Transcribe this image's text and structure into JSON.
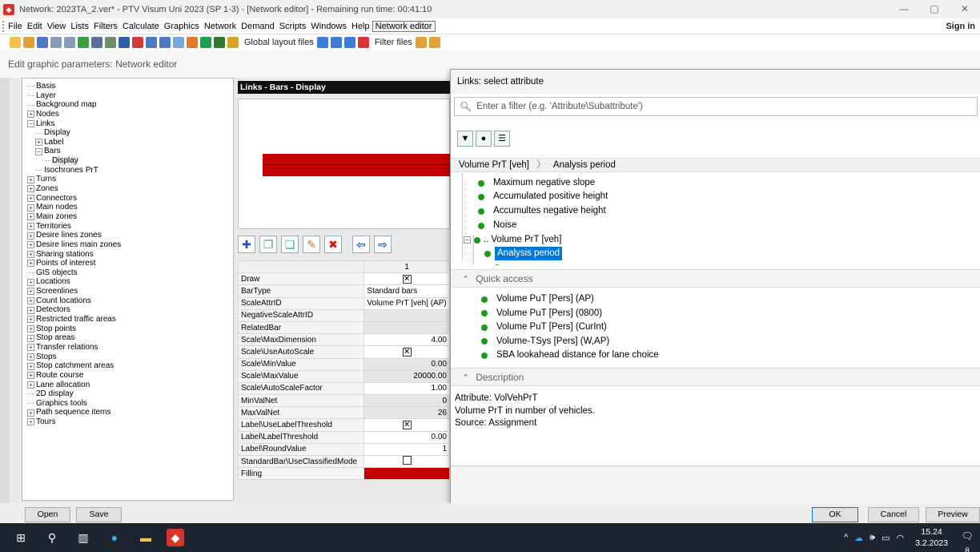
{
  "window": {
    "title": "Network: 2023TA_2.ver* - PTV Visum Uni 2023 (SP 1-3) - [Network editor] - Remaining run time: 00:41:10",
    "minimize": "—",
    "restore": "▢",
    "close": "✕"
  },
  "menu": {
    "items": [
      "File",
      "Edit",
      "View",
      "Lists",
      "Filters",
      "Calculate",
      "Graphics",
      "Network",
      "Demand",
      "Scripts",
      "Windows",
      "Help",
      "Network editor"
    ],
    "sign_in": "Sign in"
  },
  "toolbar": {
    "global_layout": "Global layout files",
    "filter_files": "Filter files"
  },
  "dialog": {
    "title": "Edit graphic parameters: Network editor"
  },
  "tree": [
    {
      "label": "Basis",
      "type": "leaf",
      "indent": 0
    },
    {
      "label": "Layer",
      "type": "leaf",
      "indent": 0
    },
    {
      "label": "Background map",
      "type": "leaf",
      "indent": 0
    },
    {
      "label": "Nodes",
      "type": "plus",
      "indent": 0
    },
    {
      "label": "Links",
      "type": "minus",
      "indent": 0
    },
    {
      "label": "Display",
      "type": "leaf",
      "indent": 1
    },
    {
      "label": "Label",
      "type": "plus",
      "indent": 1
    },
    {
      "label": "Bars",
      "type": "minus",
      "indent": 1
    },
    {
      "label": "Display",
      "type": "leaf",
      "indent": 2,
      "selected": true
    },
    {
      "label": "Isochrones PrT",
      "type": "leaf",
      "indent": 1
    },
    {
      "label": "Turns",
      "type": "plus",
      "indent": 0
    },
    {
      "label": "Zones",
      "type": "plus",
      "indent": 0
    },
    {
      "label": "Connectors",
      "type": "plus",
      "indent": 0
    },
    {
      "label": "Main nodes",
      "type": "plus",
      "indent": 0
    },
    {
      "label": "Main zones",
      "type": "plus",
      "indent": 0
    },
    {
      "label": "Territories",
      "type": "plus",
      "indent": 0
    },
    {
      "label": "Desire lines zones",
      "type": "plus",
      "indent": 0
    },
    {
      "label": "Desire lines main zones",
      "type": "plus",
      "indent": 0
    },
    {
      "label": "Sharing stations",
      "type": "plus",
      "indent": 0
    },
    {
      "label": "Points of interest",
      "type": "plus",
      "indent": 0
    },
    {
      "label": "GIS objects",
      "type": "leaf",
      "indent": 0
    },
    {
      "label": "Locations",
      "type": "plus",
      "indent": 0
    },
    {
      "label": "Screenlines",
      "type": "plus",
      "indent": 0
    },
    {
      "label": "Count locations",
      "type": "plus",
      "indent": 0
    },
    {
      "label": "Detectors",
      "type": "plus",
      "indent": 0
    },
    {
      "label": "Restricted traffic areas",
      "type": "plus",
      "indent": 0
    },
    {
      "label": "Stop points",
      "type": "plus",
      "indent": 0
    },
    {
      "label": "Stop areas",
      "type": "plus",
      "indent": 0
    },
    {
      "label": "Transfer relations",
      "type": "plus",
      "indent": 0
    },
    {
      "label": "Stops",
      "type": "plus",
      "indent": 0
    },
    {
      "label": "Stop catchment areas",
      "type": "plus",
      "indent": 0
    },
    {
      "label": "Route course",
      "type": "plus",
      "indent": 0
    },
    {
      "label": "Lane allocation",
      "type": "plus",
      "indent": 0
    },
    {
      "label": "2D display",
      "type": "leaf",
      "indent": 0
    },
    {
      "label": "Graphics tools",
      "type": "leaf",
      "indent": 0
    },
    {
      "label": "Path sequence items",
      "type": "plus",
      "indent": 0
    },
    {
      "label": "Tours",
      "type": "plus",
      "indent": 0
    }
  ],
  "preview": {
    "header": "Links - Bars - Display"
  },
  "grid": {
    "column": "1",
    "rows": [
      {
        "key": "Draw",
        "value": "",
        "kind": "checked"
      },
      {
        "key": "BarType",
        "value": "Standard bars",
        "kind": "text-left"
      },
      {
        "key": "ScaleAttrID",
        "value": "Volume PrT [veh] (AP)",
        "kind": "text-left"
      },
      {
        "key": "NegativeScaleAttrID",
        "value": "",
        "kind": "gray"
      },
      {
        "key": "RelatedBar",
        "value": "",
        "kind": "gray"
      },
      {
        "key": "Scale\\MaxDimension",
        "value": "4.00",
        "kind": "num"
      },
      {
        "key": "Scale\\UseAutoScale",
        "value": "",
        "kind": "checked"
      },
      {
        "key": "Scale\\MinValue",
        "value": "0.00",
        "kind": "num-gray"
      },
      {
        "key": "Scale\\MaxValue",
        "value": "20000.00",
        "kind": "num-gray"
      },
      {
        "key": "Scale\\AutoScaleFactor",
        "value": "1.00",
        "kind": "num"
      },
      {
        "key": "MinValNet",
        "value": "0",
        "kind": "num-gray"
      },
      {
        "key": "MaxValNet",
        "value": "26",
        "kind": "num-gray"
      },
      {
        "key": "Label\\UseLabelThreshold",
        "value": "",
        "kind": "checked"
      },
      {
        "key": "Label\\LabelThreshold",
        "value": "0.00",
        "kind": "num"
      },
      {
        "key": "Label\\RoundValue",
        "value": "1",
        "kind": "num"
      },
      {
        "key": "StandardBar\\UseClassifiedMode",
        "value": "",
        "kind": "unchecked"
      },
      {
        "key": "Filling",
        "value": "",
        "kind": "fill"
      }
    ]
  },
  "select_panel": {
    "title": "Links: select attribute",
    "search_placeholder": "Enter a filter (e.g. 'Attribute\\Subattribute')",
    "crumb_1": "Volume PrT [veh]",
    "crumb_2": "Analysis period",
    "list": [
      "Maximum negative slope",
      "Accumulated positive height",
      "Accumultes negative height",
      "Noise",
      "Volume PrT [veh]",
      "Analysis period"
    ],
    "quick_access_title": "Quick access",
    "quick_access": [
      "Volume PuT [Pers] (AP)",
      "Volume PuT [Pers] (0800)",
      "Volume PuT [Pers] (CurInt)",
      "Volume-TSys [Pers] (W,AP)",
      "SBA lookahead distance for lane choice"
    ],
    "description_title": "Description",
    "description": [
      "Attribute: VolVehPrT",
      "Volume PrT in number of vehicles.",
      "Source: Assignment"
    ]
  },
  "buttons": {
    "open": "Open",
    "save": "Save",
    "ok": "OK",
    "cancel": "Cancel",
    "preview": "Preview"
  },
  "taskbar": {
    "time": "15.24",
    "date": "3.2.2023",
    "badge": "8"
  },
  "colors": {
    "bar_red": "#c40000",
    "selection_blue": "#0078d7",
    "dot_green": "#1a9b1a"
  }
}
